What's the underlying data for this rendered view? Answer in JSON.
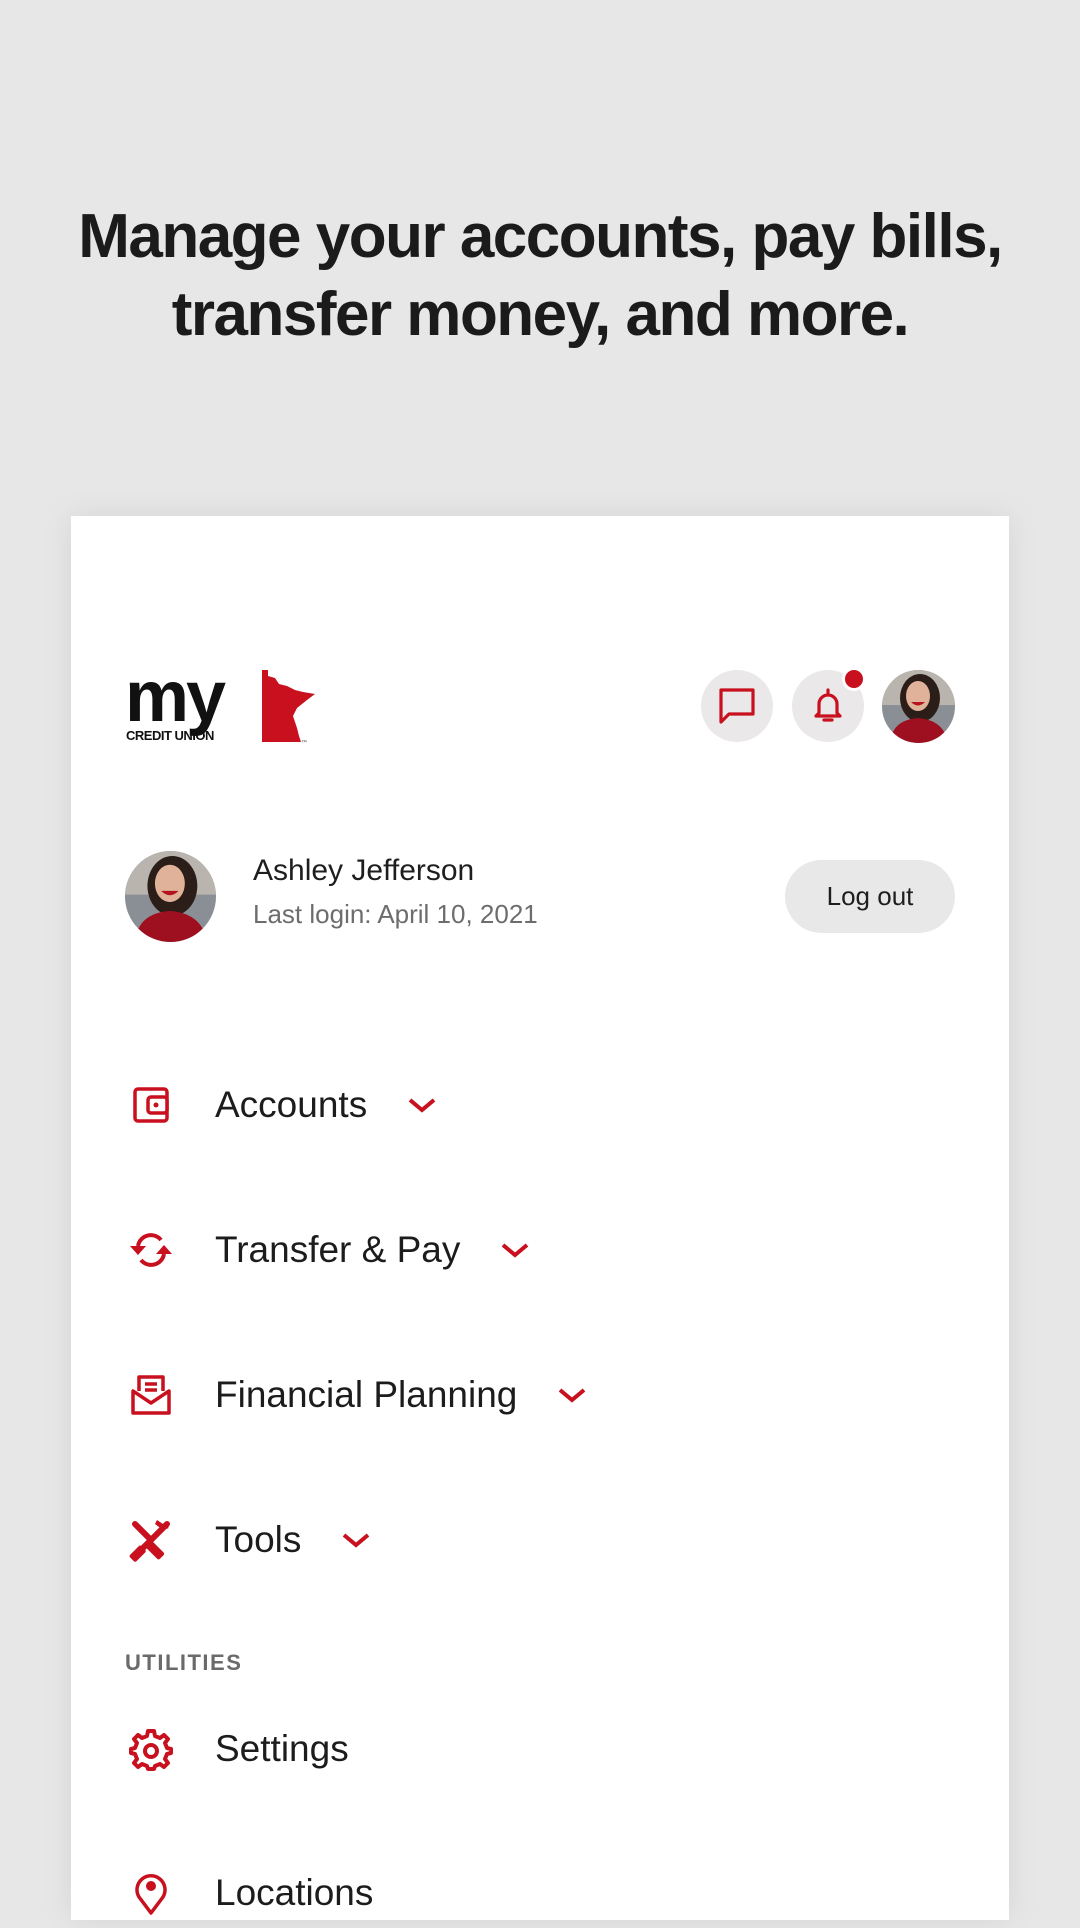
{
  "headline": {
    "line1": "Manage your accounts, pay bills,",
    "line2": "transfer money, and more."
  },
  "brand": {
    "logo_word": "my",
    "logo_sub": "CREDIT UNION",
    "logo_tm": "™",
    "accent_color": "#c8101e"
  },
  "header": {
    "icons": [
      "message-icon",
      "bell-icon",
      "avatar"
    ],
    "notification_badge": true
  },
  "profile": {
    "name": "Ashley Jefferson",
    "last_login": "Last login: April 10, 2021",
    "logout_label": "Log out"
  },
  "nav": {
    "items": [
      {
        "label": "Accounts",
        "icon": "wallet-icon",
        "expandable": true
      },
      {
        "label": "Transfer & Pay",
        "icon": "transfer-icon",
        "expandable": true
      },
      {
        "label": "Financial Planning",
        "icon": "envelope-icon",
        "expandable": true
      },
      {
        "label": "Tools",
        "icon": "tools-icon",
        "expandable": true
      }
    ]
  },
  "utilities": {
    "section_label": "UTILITIES",
    "items": [
      {
        "label": "Settings",
        "icon": "gear-icon"
      },
      {
        "label": "Locations",
        "icon": "location-pin-icon"
      }
    ]
  }
}
